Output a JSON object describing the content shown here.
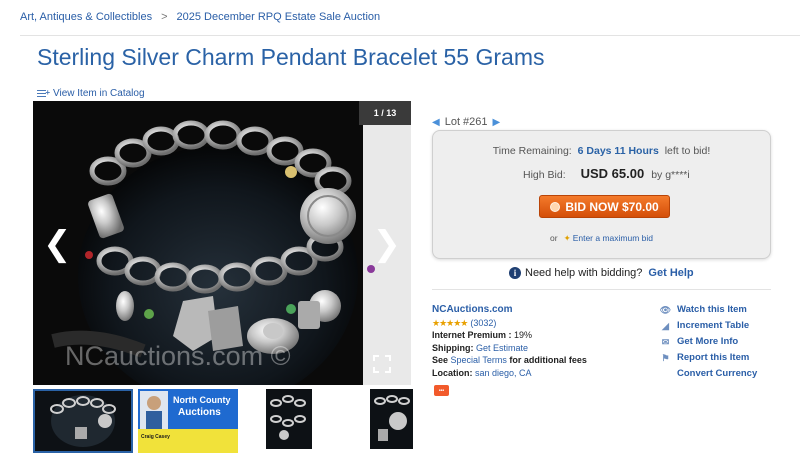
{
  "breadcrumb": {
    "items": [
      "Art, Antiques & Collectibles",
      "2025 December RPQ Estate Sale Auction"
    ],
    "separator": ">"
  },
  "title": "Sterling Silver Charm Pendant Bracelet 55 Grams",
  "catalog_link": "View Item in Catalog",
  "gallery": {
    "counter": "1 / 13",
    "watermark": "NCauctions.com ©",
    "prev_icon": "chevron-left-icon",
    "next_icon": "chevron-right-icon",
    "fullscreen_icon": "fullscreen-icon"
  },
  "thumbnails": {
    "count": 4,
    "selected_index": 0,
    "auction_logo_line1": "North County",
    "auction_logo_line2": "Auctions",
    "contact_name": "Craig Casey"
  },
  "lot": {
    "label": "Lot #261"
  },
  "bid_box": {
    "time_label": "Time Remaining:",
    "time_value": "6 Days 11 Hours",
    "time_suffix": "left to bid!",
    "high_bid_label": "High Bid:",
    "high_bid_amount": "USD 65.00",
    "high_bid_by": "by g****i",
    "bid_button": "BID NOW $70.00",
    "or_text": "or",
    "max_bid_link": "Enter a maximum bid"
  },
  "help": {
    "text": "Need help with bidding?",
    "link": "Get Help"
  },
  "seller": {
    "name": "NCAuctions.com",
    "stars": "★★★★★",
    "rating": 5,
    "reviews": "(3032)",
    "premium_label": "Internet Premium :",
    "premium_value": "19%",
    "shipping_label": "Shipping:",
    "shipping_link": "Get Estimate",
    "see_text": "See",
    "terms_link": "Special Terms",
    "terms_suffix": "for additional fees",
    "location_label": "Location:",
    "location_value": "san diego, CA"
  },
  "side_links": [
    {
      "label": "Watch this Item",
      "icon": "eye-icon"
    },
    {
      "label": "Increment Table",
      "icon": "chart-icon"
    },
    {
      "label": "Get More Info",
      "icon": "mail-icon"
    },
    {
      "label": "Report this Item",
      "icon": "flag-icon"
    },
    {
      "label": "Convert Currency",
      "icon": ""
    }
  ],
  "colors": {
    "link": "#2a5ea7",
    "title": "#2a62a6",
    "bid_button": "#e8620f",
    "stars": "#e8a000"
  }
}
